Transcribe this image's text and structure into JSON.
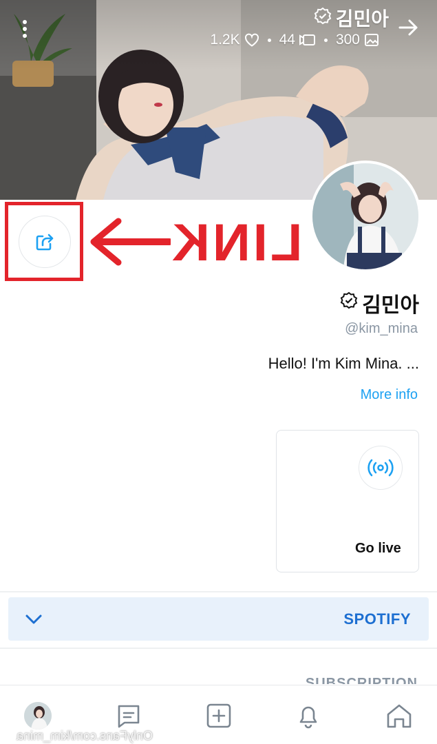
{
  "cover": {
    "title": "김민아",
    "stats": {
      "photos": "300",
      "videos": "44",
      "likes": "1.2K"
    }
  },
  "annotation": {
    "label": "LINK"
  },
  "profile": {
    "name": "김민아",
    "handle": "@kim_mina",
    "bio": "Hello! I'm Kim Mina. ...",
    "more_info": "More info"
  },
  "live_card": {
    "label": "Go live"
  },
  "sections": {
    "spotify": "SPOTIFY",
    "subscription": "SUBSCRIPTION"
  },
  "watermark": "OnlyFans.com/kim_mina",
  "colors": {
    "accent": "#1da1f2",
    "spotify_bg": "#e8f1fb",
    "spotify_text": "#1d6fd1",
    "annotation_red": "#e3242b",
    "muted": "#8a96a3"
  },
  "icons": {
    "back": "arrow-right-icon",
    "menu": "vertical-dots-icon",
    "verified": "verified-badge-icon",
    "link": "share-link-icon",
    "live": "broadcast-icon",
    "expand": "chevron-down-icon",
    "nav": [
      "home-icon",
      "bell-icon",
      "plus-square-icon",
      "message-icon",
      "avatar"
    ]
  }
}
